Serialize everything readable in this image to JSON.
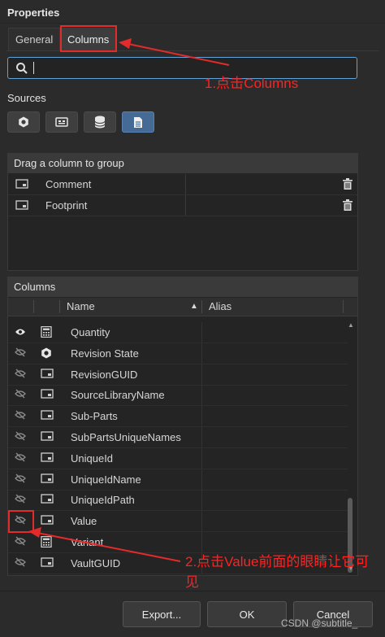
{
  "panel_title": "Properties",
  "tabs": [
    {
      "label": "General"
    },
    {
      "label": "Columns"
    }
  ],
  "search": {
    "value": "",
    "placeholder": ""
  },
  "sources": {
    "label": "Sources",
    "buttons": [
      {
        "icon": "component-icon"
      },
      {
        "icon": "pcb-icon"
      },
      {
        "icon": "database-icon"
      },
      {
        "icon": "document-icon",
        "active": true
      }
    ]
  },
  "group_panel": {
    "title": "Drag a column to group",
    "rows": [
      {
        "label": "Comment"
      },
      {
        "label": "Footprint"
      }
    ]
  },
  "columns_panel": {
    "title": "Columns",
    "headers": {
      "name": "Name",
      "alias": "Alias"
    },
    "rows": [
      {
        "name": "Quantity",
        "visible": true,
        "icon": "calculator-icon"
      },
      {
        "name": "Revision State",
        "visible": false,
        "icon": "gear-icon"
      },
      {
        "name": "RevisionGUID",
        "visible": false,
        "icon": "field-icon"
      },
      {
        "name": "SourceLibraryName",
        "visible": false,
        "icon": "field-icon"
      },
      {
        "name": "Sub-Parts",
        "visible": false,
        "icon": "field-icon"
      },
      {
        "name": "SubPartsUniqueNames",
        "visible": false,
        "icon": "field-icon"
      },
      {
        "name": "UniqueId",
        "visible": false,
        "icon": "field-icon"
      },
      {
        "name": "UniqueIdName",
        "visible": false,
        "icon": "field-icon"
      },
      {
        "name": "UniqueIdPath",
        "visible": false,
        "icon": "field-icon"
      },
      {
        "name": "Value",
        "visible": false,
        "icon": "field-icon"
      },
      {
        "name": "Variant",
        "visible": false,
        "icon": "calculator-icon"
      },
      {
        "name": "VaultGUID",
        "visible": false,
        "icon": "field-icon"
      }
    ]
  },
  "footer": {
    "export_label": "Export...",
    "ok_label": "OK",
    "cancel_label": "Cancel"
  },
  "annotations": {
    "step1": "1.点击Columns",
    "step2": "2.点击Value前面的眼睛让它可见"
  },
  "watermark": "CSDN @subtitle_",
  "colors": {
    "accent": "#5fa3d8",
    "annotation": "#e32b2b",
    "active_source": "#466a96"
  }
}
